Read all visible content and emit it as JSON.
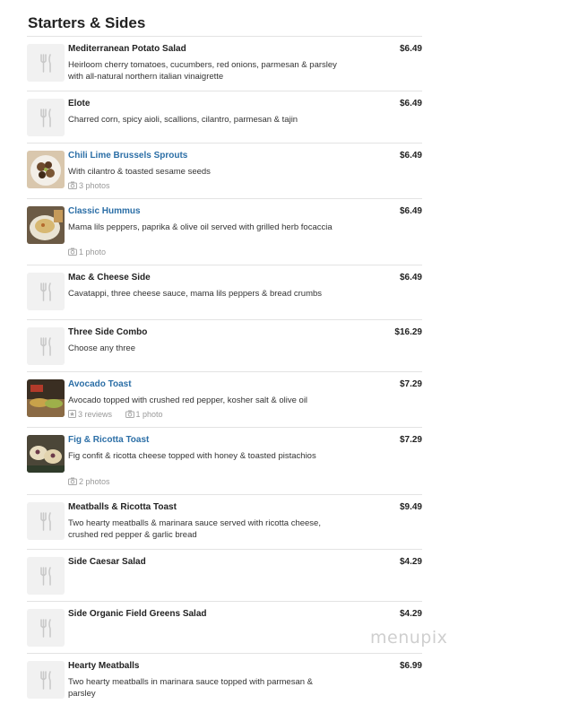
{
  "section_title": "Starters & Sides",
  "watermark": "menupix",
  "items": [
    {
      "name": "Mediterranean Potato Salad",
      "description": "Heirloom cherry tomatoes, cucumbers, red onions, parmesan & parsley with all-natural northern italian vinaigrette",
      "price": "$6.49",
      "photo": false
    },
    {
      "name": "Elote",
      "description": "Charred corn, spicy aioli, scallions, cilantro, parmesan & tajin",
      "price": "$6.49",
      "photo": false
    },
    {
      "name": "Chili Lime Brussels Sprouts",
      "description": "With cilantro & toasted sesame seeds",
      "price": "$6.49",
      "photo": true,
      "photos_label": "3 photos"
    },
    {
      "name": "Classic Hummus",
      "description": "Mama lils peppers, paprika & olive oil served with grilled herb focaccia",
      "price": "$6.49",
      "photo": true,
      "photos_label": "1 photo"
    },
    {
      "name": "Mac & Cheese Side",
      "description": "Cavatappi, three cheese sauce, mama lils peppers & bread crumbs",
      "price": "$6.49",
      "photo": false
    },
    {
      "name": "Three Side Combo",
      "description": "Choose any three",
      "price": "$16.29",
      "photo": false
    },
    {
      "name": "Avocado Toast",
      "description": "Avocado topped with crushed red pepper, kosher salt & olive oil",
      "price": "$7.29",
      "photo": true,
      "reviews_label": "3 reviews",
      "photos_label": "1 photo"
    },
    {
      "name": "Fig & Ricotta Toast",
      "description": "Fig confit & ricotta cheese topped with honey & toasted pistachios",
      "price": "$7.29",
      "photo": true,
      "photos_label": "2 photos"
    },
    {
      "name": "Meatballs & Ricotta Toast",
      "description": "Two hearty meatballs & marinara sauce served with ricotta cheese, crushed red pepper & garlic bread",
      "price": "$9.49",
      "photo": false
    },
    {
      "name": "Side Caesar Salad",
      "description": "",
      "price": "$4.29",
      "photo": false
    },
    {
      "name": "Side Organic Field Greens Salad",
      "description": "",
      "price": "$4.29",
      "photo": false
    },
    {
      "name": "Hearty Meatballs",
      "description": "Two hearty meatballs in marinara sauce topped with parmesan & parsley",
      "price": "$6.99",
      "photo": false
    }
  ]
}
